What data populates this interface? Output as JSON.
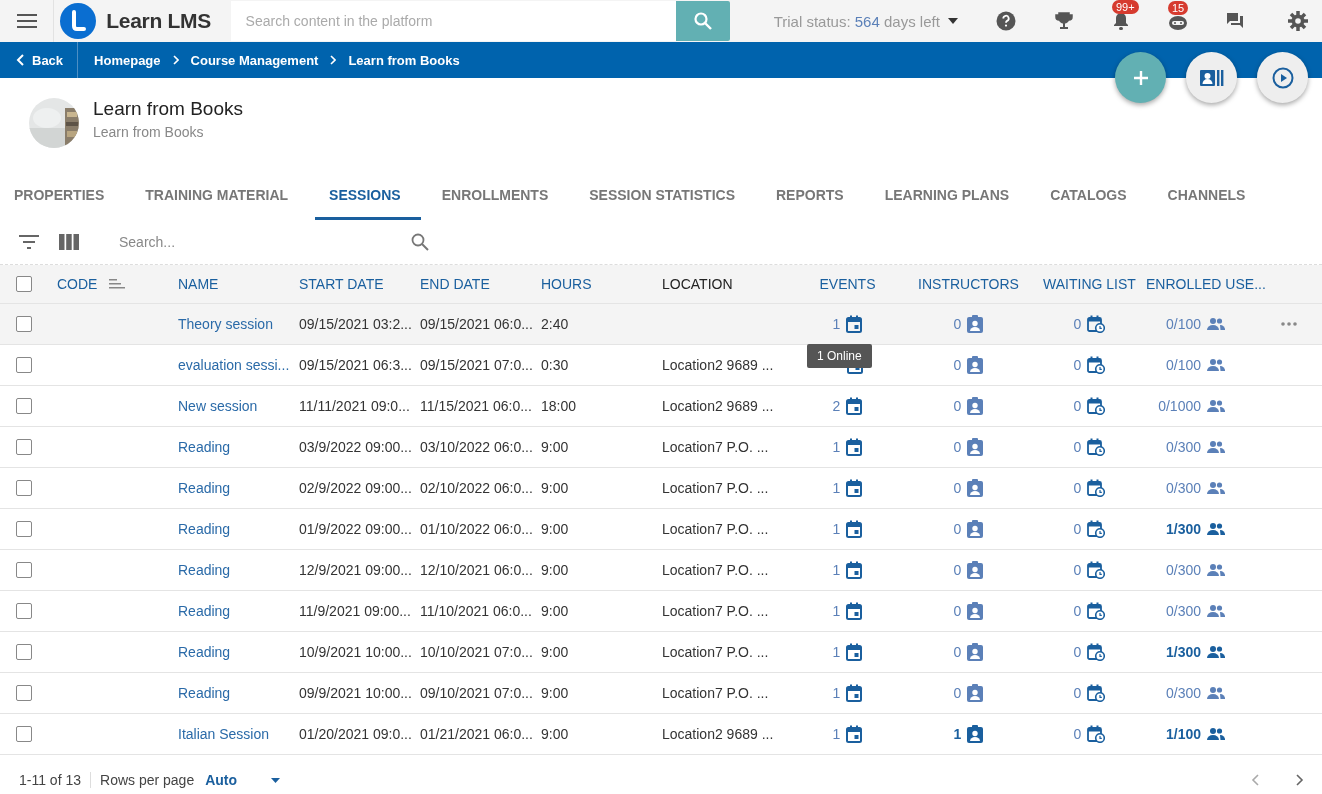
{
  "topbar": {
    "logo_text": "Learn LMS",
    "search_placeholder": "Search content in the platform",
    "trial_label": "Trial status: ",
    "trial_days": "564",
    "trial_suffix": " days left",
    "notifications_badge": "99+",
    "bot_badge": "15"
  },
  "breadcrumb": {
    "back": "Back",
    "items": [
      "Homepage",
      "Course Management",
      "Learn from Books"
    ]
  },
  "course": {
    "title": "Learn from Books",
    "subtitle": "Learn from Books"
  },
  "tabs": [
    {
      "label": "PROPERTIES",
      "selected": false
    },
    {
      "label": "TRAINING MATERIAL",
      "selected": false
    },
    {
      "label": "SESSIONS",
      "selected": true
    },
    {
      "label": "ENROLLMENTS",
      "selected": false
    },
    {
      "label": "SESSION STATISTICS",
      "selected": false
    },
    {
      "label": "REPORTS",
      "selected": false
    },
    {
      "label": "LEARNING PLANS",
      "selected": false
    },
    {
      "label": "CATALOGS",
      "selected": false
    },
    {
      "label": "CHANNELS",
      "selected": false
    }
  ],
  "toolbar": {
    "search_placeholder": "Search..."
  },
  "table": {
    "select_all_checked": false,
    "columns": [
      {
        "label": "CODE",
        "sortable": true
      },
      {
        "label": "NAME",
        "sortable": true
      },
      {
        "label": "START DATE",
        "sortable": true
      },
      {
        "label": "END DATE",
        "sortable": true
      },
      {
        "label": "HOURS",
        "sortable": true
      },
      {
        "label": "LOCATION",
        "sortable": false
      },
      {
        "label": "EVENTS",
        "sortable": true
      },
      {
        "label": "INSTRUCTORS",
        "sortable": true
      },
      {
        "label": "WAITING LIST",
        "sortable": true
      },
      {
        "label": "ENROLLED USE...",
        "sortable": true
      }
    ],
    "rows": [
      {
        "checked": false,
        "hovered": true,
        "name": "Theory session",
        "start": "09/15/2021 03:2...",
        "end": "09/15/2021 06:0...",
        "hours": "2:40",
        "events": "1",
        "instructors": "0",
        "instructors_active": false,
        "waiting": "0",
        "enrolled": "0/100",
        "enrolled_active": false
      },
      {
        "checked": false,
        "hovered": false,
        "name": "evaluation sessi...",
        "start": "09/15/2021 06:3...",
        "end": "09/15/2021 07:0...",
        "hours": "0:30",
        "location": "Location2 9689 ...",
        "instructors": "0",
        "instructors_active": false,
        "waiting": "0",
        "enrolled": "0/100",
        "enrolled_active": false
      },
      {
        "checked": false,
        "hovered": false,
        "name": "New session",
        "start": "11/11/2021 09:0...",
        "end": "11/15/2021 06:0...",
        "hours": "18:00",
        "location": "Location2 9689 ...",
        "events": "2",
        "instructors": "0",
        "instructors_active": false,
        "waiting": "0",
        "enrolled": "0/1000",
        "enrolled_active": false
      },
      {
        "checked": false,
        "hovered": false,
        "name": "Reading",
        "start": "03/9/2022 09:00...",
        "end": "03/10/2022 06:0...",
        "hours": "9:00",
        "location": "Location7 P.O. ...",
        "events": "1",
        "instructors": "0",
        "instructors_active": false,
        "waiting": "0",
        "enrolled": "0/300",
        "enrolled_active": false
      },
      {
        "checked": false,
        "hovered": false,
        "name": "Reading",
        "start": "02/9/2022 09:00...",
        "end": "02/10/2022 06:0...",
        "hours": "9:00",
        "location": "Location7 P.O. ...",
        "events": "1",
        "instructors": "0",
        "instructors_active": false,
        "waiting": "0",
        "enrolled": "0/300",
        "enrolled_active": false
      },
      {
        "checked": false,
        "hovered": false,
        "name": "Reading",
        "start": "01/9/2022 09:00...",
        "end": "01/10/2022 06:0...",
        "hours": "9:00",
        "location": "Location7 P.O. ...",
        "events": "1",
        "instructors": "0",
        "instructors_active": false,
        "waiting": "0",
        "enrolled": "1/300",
        "enrolled_active": true
      },
      {
        "checked": false,
        "hovered": false,
        "name": "Reading",
        "start": "12/9/2021 09:00...",
        "end": "12/10/2021 06:0...",
        "hours": "9:00",
        "location": "Location7 P.O. ...",
        "events": "1",
        "instructors": "0",
        "instructors_active": false,
        "waiting": "0",
        "enrolled": "0/300",
        "enrolled_active": false
      },
      {
        "checked": false,
        "hovered": false,
        "name": "Reading",
        "start": "11/9/2021 09:00...",
        "end": "11/10/2021 06:0...",
        "hours": "9:00",
        "location": "Location7 P.O. ...",
        "events": "1",
        "instructors": "0",
        "instructors_active": false,
        "waiting": "0",
        "enrolled": "0/300",
        "enrolled_active": false
      },
      {
        "checked": false,
        "hovered": false,
        "name": "Reading",
        "start": "10/9/2021 10:00...",
        "end": "10/10/2021 07:0...",
        "hours": "9:00",
        "location": "Location7 P.O. ...",
        "events": "1",
        "instructors": "0",
        "instructors_active": false,
        "waiting": "0",
        "enrolled": "1/300",
        "enrolled_active": true
      },
      {
        "checked": false,
        "hovered": false,
        "name": "Reading",
        "start": "09/9/2021 10:00...",
        "end": "09/10/2021 07:0...",
        "hours": "9:00",
        "location": "Location7 P.O. ...",
        "events": "1",
        "instructors": "0",
        "instructors_active": false,
        "waiting": "0",
        "enrolled": "0/300",
        "enrolled_active": false
      },
      {
        "checked": false,
        "hovered": false,
        "name": "Italian Session",
        "start": "01/20/2021 09:0...",
        "end": "01/21/2021 06:0...",
        "hours": "9:00",
        "location": "Location2 9689 ...",
        "events": "1",
        "instructors": "1",
        "instructors_active": true,
        "waiting": "0",
        "enrolled": "1/100",
        "enrolled_active": true
      }
    ],
    "tooltip": "1 Online"
  },
  "footer": {
    "range": "1-11 of 13",
    "rows_label": "Rows per page",
    "rows_value": "Auto"
  }
}
